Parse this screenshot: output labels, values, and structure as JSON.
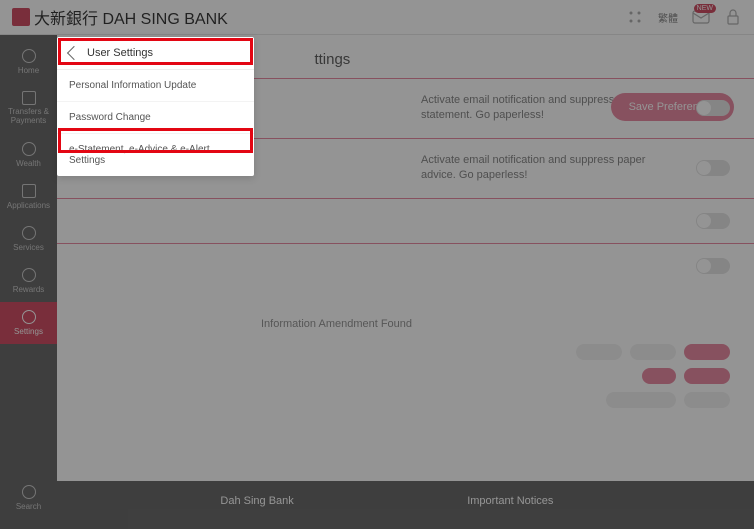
{
  "logo_text": "大新銀行 DAH SING BANK",
  "topbar": {
    "lang": "繁體"
  },
  "sidebar": {
    "items": [
      {
        "label": "Home"
      },
      {
        "label": "Transfers & Payments"
      },
      {
        "label": "Wealth"
      },
      {
        "label": "Applications"
      },
      {
        "label": "Services"
      },
      {
        "label": "Rewards"
      },
      {
        "label": "Settings"
      }
    ],
    "search": "Search"
  },
  "page": {
    "title_suffix": "ttings",
    "save": "Save Preferences",
    "rows": [
      {
        "text": "Activate email notification and suppress paper statement. Go paperless!"
      },
      {
        "text": "Activate email notification and suppress paper advice. Go paperless!"
      }
    ],
    "note": "Information Amendment Found"
  },
  "submenu": {
    "title": "User Settings",
    "items": [
      "Personal Information Update",
      "Password Change",
      "e-Statement, e-Advice & e-Alert Settings"
    ]
  },
  "footer": {
    "col1": "Dah Sing Bank",
    "col2": "Important Notices"
  }
}
